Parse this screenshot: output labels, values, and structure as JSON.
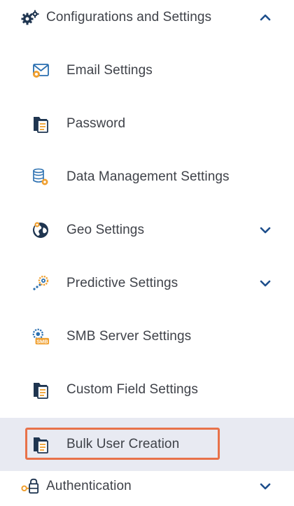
{
  "header": {
    "label": "Configurations and Settings",
    "icon": "gears-icon",
    "expanded": true
  },
  "items": [
    {
      "label": "Email Settings",
      "icon": "email-settings-icon",
      "has_submenu": false
    },
    {
      "label": "Password",
      "icon": "document-folder-icon",
      "has_submenu": false
    },
    {
      "label": "Data Management Settings",
      "icon": "database-gear-icon",
      "has_submenu": false
    },
    {
      "label": "Geo Settings",
      "icon": "globe-icon",
      "has_submenu": true
    },
    {
      "label": "Predictive Settings",
      "icon": "predictive-gear-icon",
      "has_submenu": true
    },
    {
      "label": "SMB Server Settings",
      "icon": "smb-gear-icon",
      "has_submenu": false
    },
    {
      "label": "Custom Field Settings",
      "icon": "document-folder-icon",
      "has_submenu": false
    },
    {
      "label": "Bulk User Creation",
      "icon": "document-folder-icon",
      "has_submenu": false,
      "selected": true
    }
  ],
  "footer": {
    "label": "Authentication",
    "icon": "key-lock-icon",
    "expanded": false
  },
  "colors": {
    "text": "#3f4249",
    "accent_blue": "#1e4f8c",
    "selected_bg": "#e8eaf2",
    "highlight_border": "#e8724a",
    "icon_orange": "#f0a030",
    "icon_teal": "#2a6fb0"
  }
}
